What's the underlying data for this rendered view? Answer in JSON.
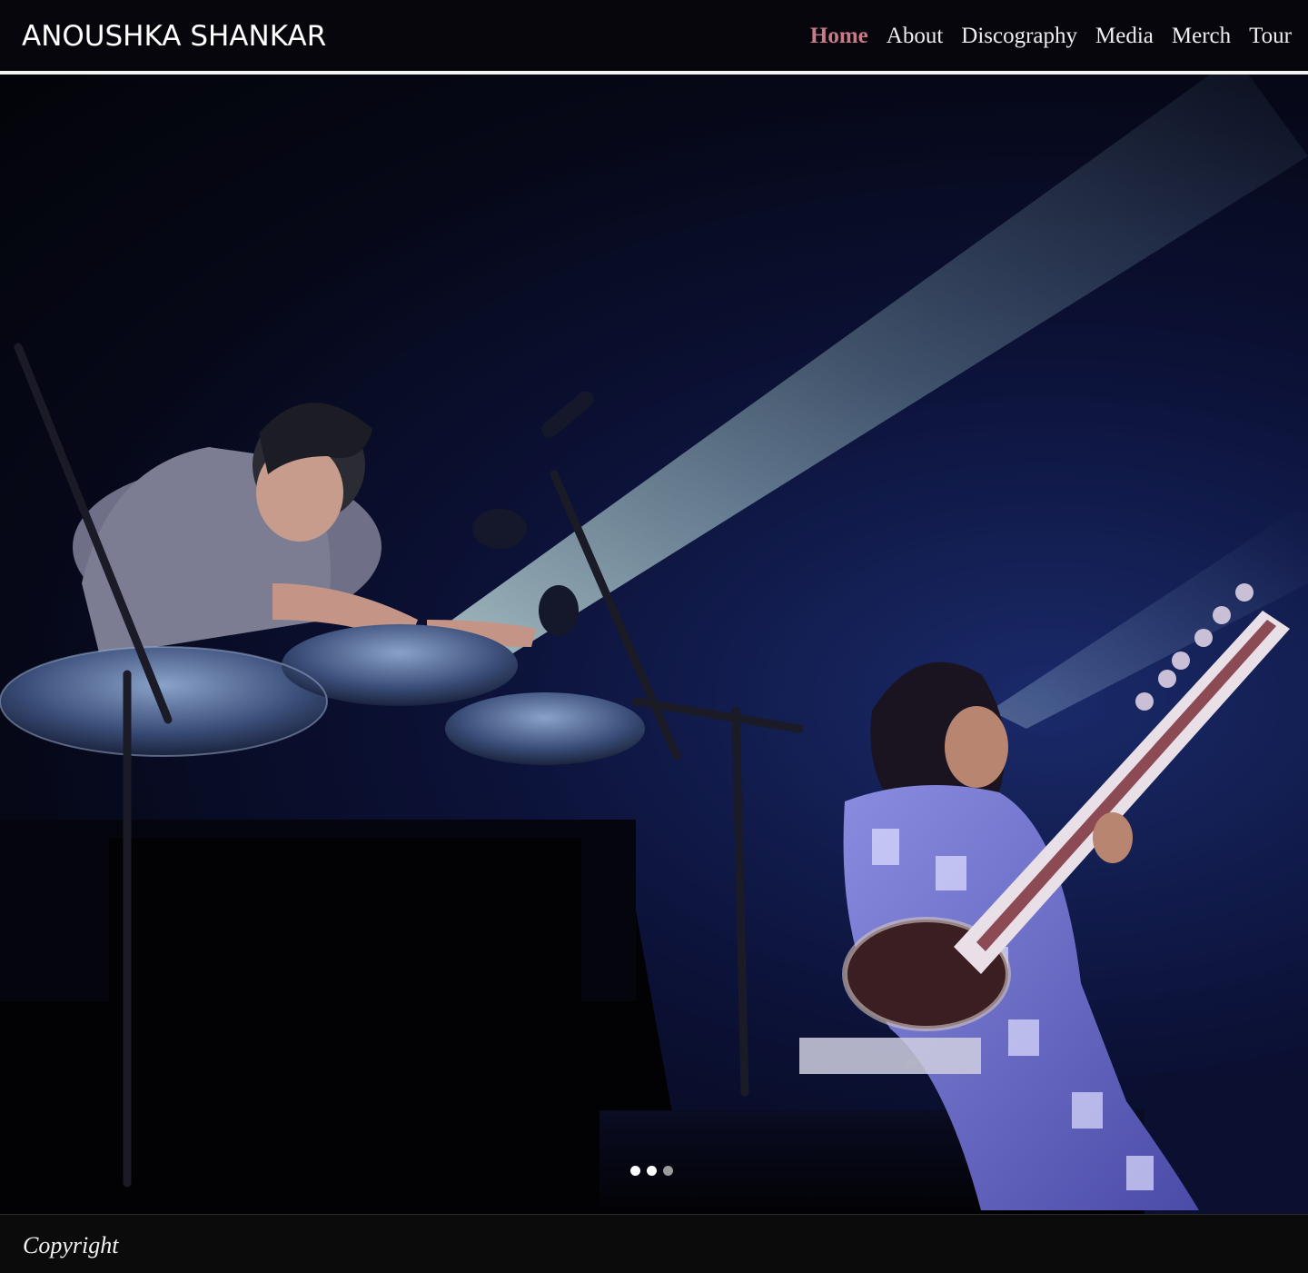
{
  "site": {
    "logo": "ANOUSHKA SHANKAR"
  },
  "nav": {
    "items": [
      {
        "label": "Home",
        "active": true
      },
      {
        "label": "About",
        "active": false
      },
      {
        "label": "Discography",
        "active": false
      },
      {
        "label": "Media",
        "active": false
      },
      {
        "label": "Merch",
        "active": false
      },
      {
        "label": "Tour",
        "active": false
      }
    ]
  },
  "hero": {
    "image_icon": "concert-photo",
    "slider": {
      "slide_count": 3,
      "active_index": 1
    }
  },
  "footer": {
    "copyright": "Copyright"
  },
  "colors": {
    "header_bg": "#06060c",
    "nav_text": "#f1eef2",
    "nav_active": "#c77b88",
    "footer_bg": "#0b0b0c"
  }
}
